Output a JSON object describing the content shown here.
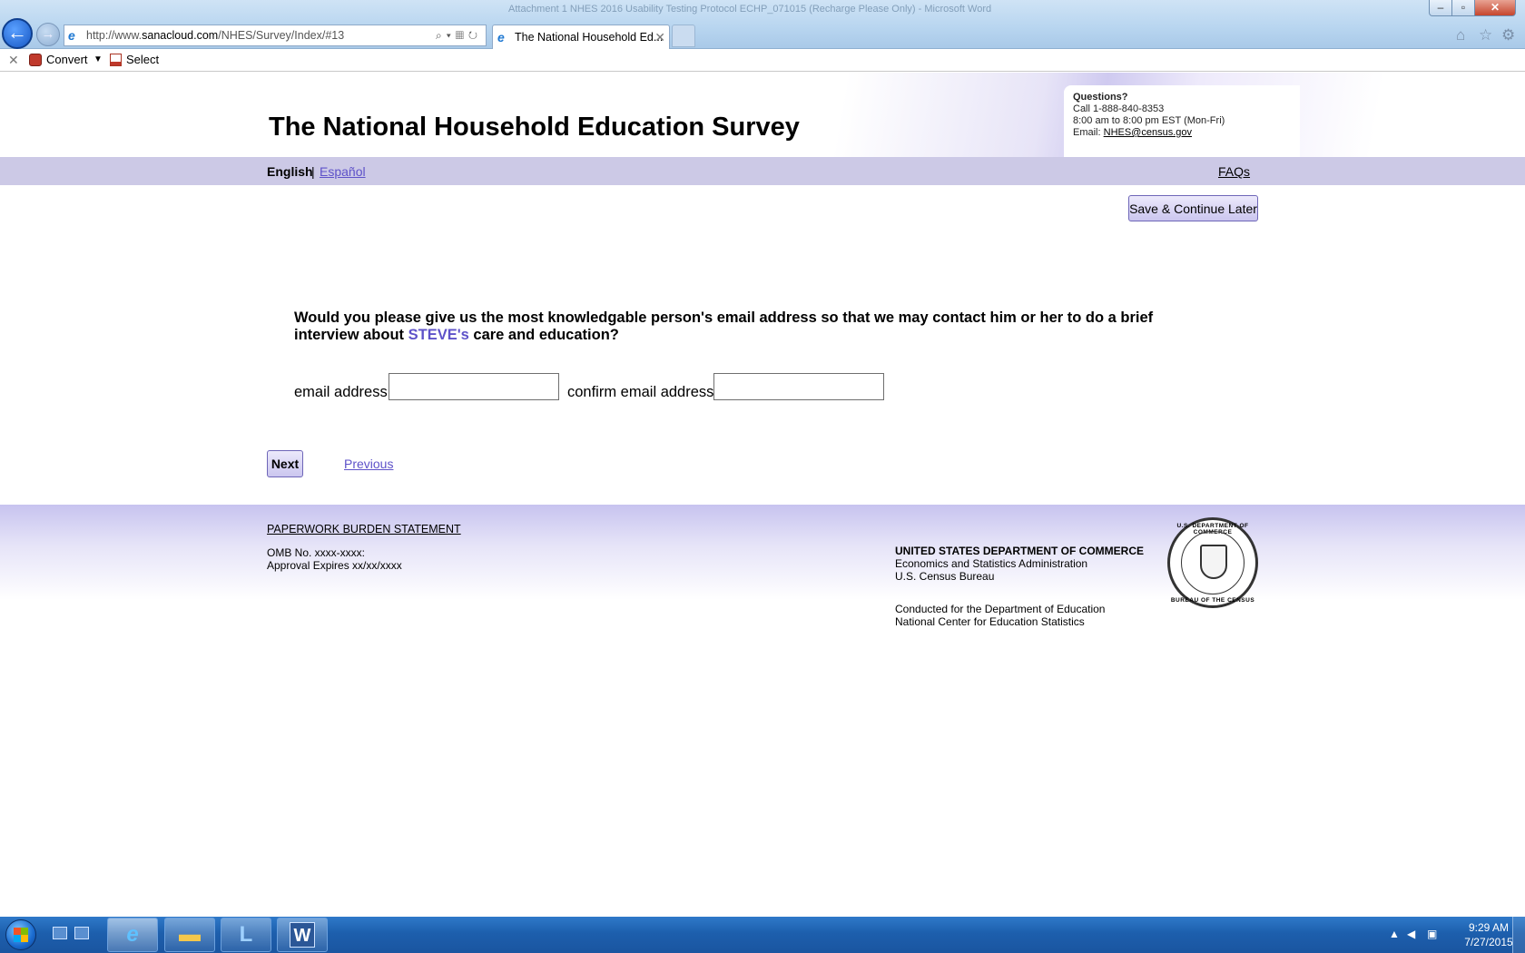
{
  "browser": {
    "window_title": "Attachment 1 NHES 2016 Usability Testing Protocol ECHP_071015 (Recharge Please Only) - Microsoft Word",
    "url_scheme": "http://www.",
    "url_host": "sanacloud.com",
    "url_path": "/NHES/Survey/Index/#13",
    "tab_title": "The National Household Ed...",
    "window_buttons": {
      "minimize": "–",
      "maximize": "▫",
      "close": "✕"
    },
    "icons": [
      "back-arrow-icon",
      "forward-arrow-icon",
      "ie-logo-icon",
      "search-icon",
      "refresh-icon",
      "home-icon",
      "star-icon",
      "gear-icon"
    ]
  },
  "command_bar": {
    "close_symbol": "✕",
    "convert_label": "Convert",
    "convert_arrow": "▼",
    "select_label": "Select"
  },
  "header": {
    "title": "The National Household Education Survey",
    "questions": {
      "heading": "Questions?",
      "phone": "Call 1-888-840-8353",
      "hours": "8:00 am to 8:00 pm EST (Mon-Fri)",
      "email_label": "Email: ",
      "email": "NHES@census.gov"
    }
  },
  "langbar": {
    "english": "English",
    "separator": "|",
    "spanish": "Español",
    "faqs": "FAQs"
  },
  "main": {
    "save_button": "Save & Continue Later",
    "question_part1": "Would you please give us the most knowledgable person's email address so that we may contact him or her to do a brief interview about ",
    "child_name": "STEVE's",
    "question_part2": " care and education?",
    "email_label": "email address",
    "email_value": "",
    "confirm_label": "confirm email address",
    "confirm_value": "",
    "next_button": "Next",
    "previous_link": "Previous"
  },
  "footer": {
    "burden_link": "PAPERWORK BURDEN STATEMENT",
    "omb_no": "OMB No. xxxx-xxxx:",
    "approval": "Approval Expires xx/xx/xxxx",
    "dept_heading": "UNITED STATES DEPARTMENT OF COMMERCE",
    "dept_line2": "Economics and Statistics Administration",
    "dept_line3": "U.S. Census Bureau",
    "conducted_line1": "Conducted for the Department of Education",
    "conducted_line2": "National Center for Education Statistics",
    "seal_top": "U.S. DEPARTMENT OF COMMERCE",
    "seal_bottom": "BUREAU OF THE CENSUS"
  },
  "taskbar": {
    "apps": [
      "internet-explorer",
      "windows-explorer",
      "lync",
      "word"
    ],
    "word_letter": "W",
    "time": "9:29 AM",
    "date": "7/27/2015"
  },
  "colors": {
    "link_purple": "#5e52c9",
    "langbar_bg": "#ccc9e6",
    "button_border": "#6e66b8",
    "taskbar_blue": "#1d5fad"
  }
}
